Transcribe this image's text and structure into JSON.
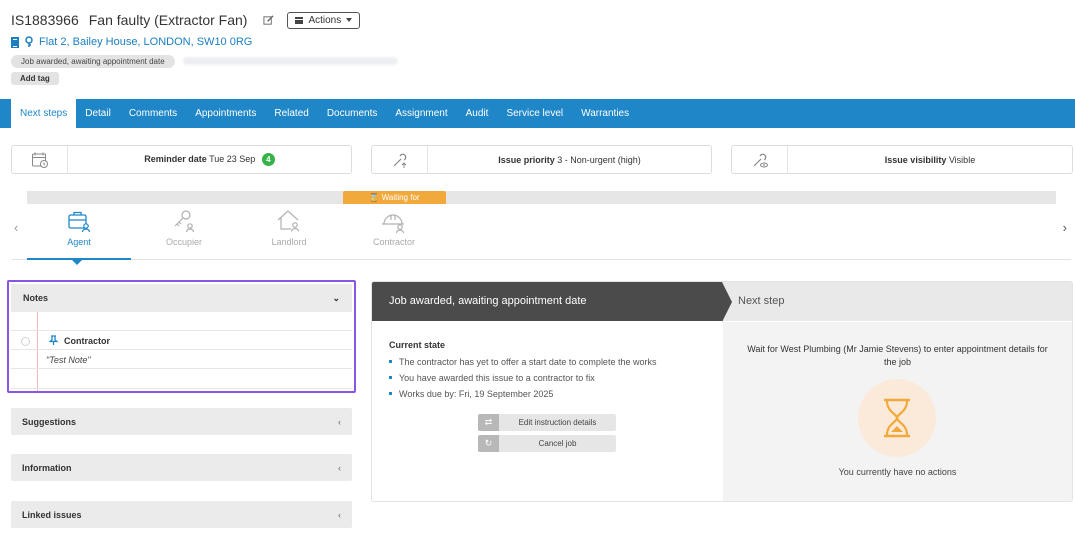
{
  "header": {
    "job_id": "IS1883966",
    "job_title": "Fan faulty (Extractor Fan)",
    "actions_label": "Actions",
    "address": "Flat 2, Bailey House, LONDON, SW10 0RG",
    "status_tag": "Job awarded, awaiting appointment date",
    "add_tag_label": "Add tag"
  },
  "tabs": [
    "Next steps",
    "Detail",
    "Comments",
    "Appointments",
    "Related",
    "Documents",
    "Assignment",
    "Audit",
    "Service level",
    "Warranties"
  ],
  "info_cards": {
    "reminder_label": "Reminder date",
    "reminder_value": "Tue 23 Sep",
    "reminder_count": "4",
    "priority_label": "Issue priority",
    "priority_value": "3 - Non-urgent (high)",
    "visibility_label": "Issue visibility",
    "visibility_value": "Visible"
  },
  "stepper": {
    "waiting_label": "Waiting for",
    "steps": [
      "Agent",
      "Occupier",
      "Landlord",
      "Contractor"
    ]
  },
  "notes": {
    "title": "Notes",
    "note_title": "Contractor",
    "note_text": "\"Test Note\""
  },
  "accordions": {
    "suggestions": "Suggestions",
    "information": "Information",
    "linked_issues": "Linked issues"
  },
  "main": {
    "header": "Job awarded, awaiting appointment date",
    "next_step_header": "Next step",
    "current_state_title": "Current state",
    "bullets": [
      "The contractor has yet to offer a start date to complete the works",
      "You have awarded this issue to a contractor to fix",
      "Works due by: Fri, 19 September 2025"
    ],
    "edit_button": "Edit instruction details",
    "cancel_button": "Cancel job",
    "wait_text": "Wait for West Plumbing (Mr Jamie Stevens) to enter appointment details for the job",
    "no_actions": "You currently have no actions"
  },
  "colors": {
    "accent": "#1f86c8",
    "waiting": "#f2a93b",
    "badge": "#37b34a",
    "notes_border": "#8b55e4"
  }
}
